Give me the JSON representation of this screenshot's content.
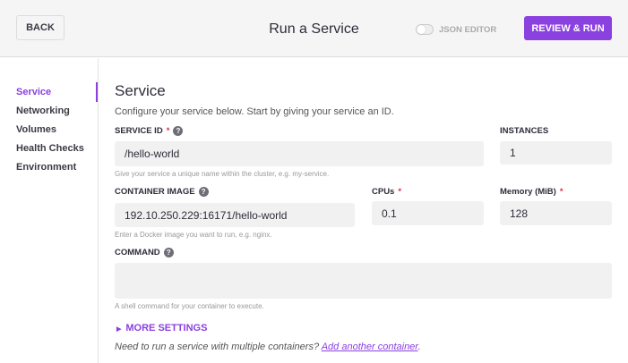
{
  "header": {
    "back_label": "BACK",
    "title": "Run a Service",
    "json_editor_label": "JSON EDITOR",
    "json_editor_on": false,
    "review_label": "REVIEW & RUN",
    "accent": "#8b40e0"
  },
  "sidebar": {
    "items": [
      {
        "label": "Service",
        "active": true
      },
      {
        "label": "Networking"
      },
      {
        "label": "Volumes"
      },
      {
        "label": "Health Checks"
      },
      {
        "label": "Environment"
      }
    ]
  },
  "main": {
    "heading": "Service",
    "description": "Configure your service below. Start by giving your service an ID.",
    "service_id": {
      "label": "SERVICE ID",
      "required": "*",
      "value": "/hello-world",
      "hint": "Give your service a unique name within the cluster, e.g. my-service."
    },
    "instances": {
      "label": "INSTANCES",
      "value": "1"
    },
    "container_image": {
      "label": "CONTAINER IMAGE",
      "value": "192.10.250.229:16171/hello-world",
      "hint": "Enter a Docker image you want to run, e.g. nginx."
    },
    "cpus": {
      "label": "CPUs",
      "required": "*",
      "value": "0.1"
    },
    "memory": {
      "label": "Memory (MiB)",
      "required": "*",
      "value": "128"
    },
    "command": {
      "label": "COMMAND",
      "value": "",
      "hint": "A shell command for your container to execute."
    },
    "more_settings": "MORE SETTINGS",
    "footer_text": "Need to run a service with multiple containers? ",
    "footer_link": "Add another container",
    "footer_end": "."
  }
}
